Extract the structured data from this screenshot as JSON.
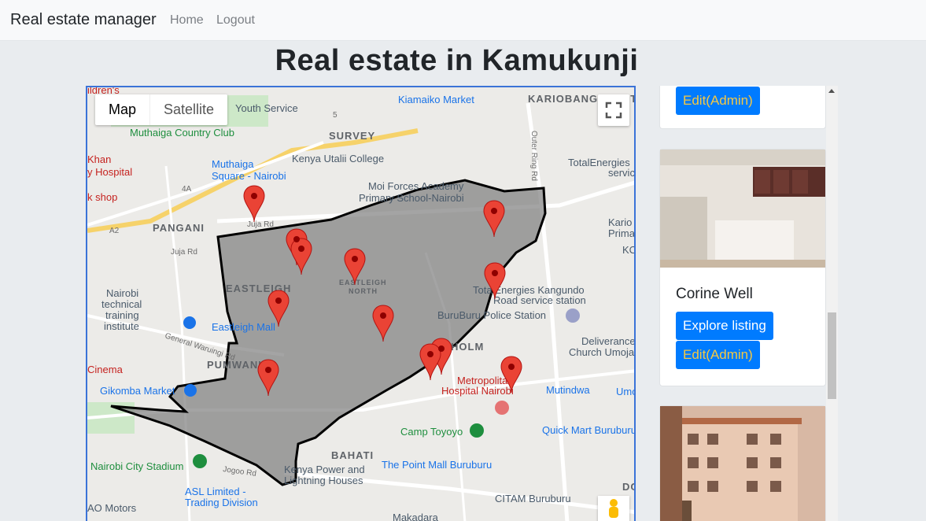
{
  "navbar": {
    "brand": "Real estate manager",
    "links": [
      "Home",
      "Logout"
    ]
  },
  "page": {
    "title": "Real estate in Kamukunji"
  },
  "map": {
    "type_controls": [
      "Map",
      "Satellite"
    ],
    "labels": {
      "childrens": "ildren's",
      "youth_service": "Youth Service",
      "kiamaiko_market": "Kiamaiko Market",
      "kariobangi_north": "KARIOBANGI NORTH",
      "muthaiga_country_club": "Muthaiga Country Club",
      "survey": "SURVEY",
      "khan": "Khan",
      "hospital": "y Hospital",
      "muthaiga_square": "Muthaiga",
      "muthaiga_square2": "Square - Nairobi",
      "kenya_utalii": "Kenya Utalii College",
      "totalenergies": "TotalEnergies",
      "servic": "servic",
      "moi_forces": "Moi Forces Academy",
      "primary_school": "Primary School-Nairobi",
      "shop": "k shop",
      "pangani": "PANGANI",
      "kario": "Kario",
      "prima": "Prima",
      "kc": "KC",
      "eastleigh": "EASTLEIGH",
      "eastleigh_north1": "EASTLEIGH",
      "eastleigh_north2": "NORTH",
      "nairobi_technical1": "Nairobi",
      "nairobi_technical2": "technical",
      "nairobi_technical3": "training",
      "nairobi_technical4": "institute",
      "total_kangundo1": "TotalEnergies Kangundo",
      "total_kangundo2": "Road service station",
      "eastleigh_mall": "Eastleigh Mall",
      "buruburu_police": "BuruBuru Police Station",
      "deliverance1": "Deliverance",
      "deliverance2": "Church Umoja",
      "pumwani": "PUMWANI",
      "shauri": "HOLM",
      "cinema": "Cinema",
      "metropolitan1": "Metropolitan",
      "metropolitan2": "Hospital Nairobi",
      "gikomba": "Gikomba Market",
      "mutindwa": "Mutindwa",
      "umo": "Umo",
      "camp_toyoyo": "Camp Toyoyo",
      "quick_mart": "Quick Mart Buruburu",
      "bahati": "BAHATI",
      "kenya_power1": "Kenya Power and",
      "kenya_power2": "Lightning Houses",
      "point_mall": "The Point Mall Buruburu",
      "nairobi_stadium": "Nairobi City Stadium",
      "asl1": "ASL Limited -",
      "asl2": "Trading Division",
      "citam": "CITAM Buruburu",
      "ao_motors": "AO Motors",
      "makadara": "Makadara",
      "do": "DO",
      "juja_rd": "Juja Rd",
      "juja_rd2": "Juja Rd",
      "general_waruingi": "General Waruingi Rd",
      "outer_ring": "Outer Ring Rd",
      "jogoo_rd": "Jogoo Rd",
      "a2": "A2",
      "a4": "4A",
      "r5": "5"
    },
    "icons": [
      "fullscreen-icon",
      "pegman-icon",
      "map-marker-icon"
    ]
  },
  "listings": {
    "card1": {
      "edit_label": "Edit(Admin)"
    },
    "card2": {
      "title": "Corine Well",
      "explore_label": "Explore listing",
      "edit_label": "Edit(Admin)"
    }
  },
  "colors": {
    "accent": "#007bff",
    "edit_text": "#f5c842",
    "map_border": "#3b73d8",
    "marker": "#ea4335",
    "region_fill": "#7d7d7d"
  }
}
